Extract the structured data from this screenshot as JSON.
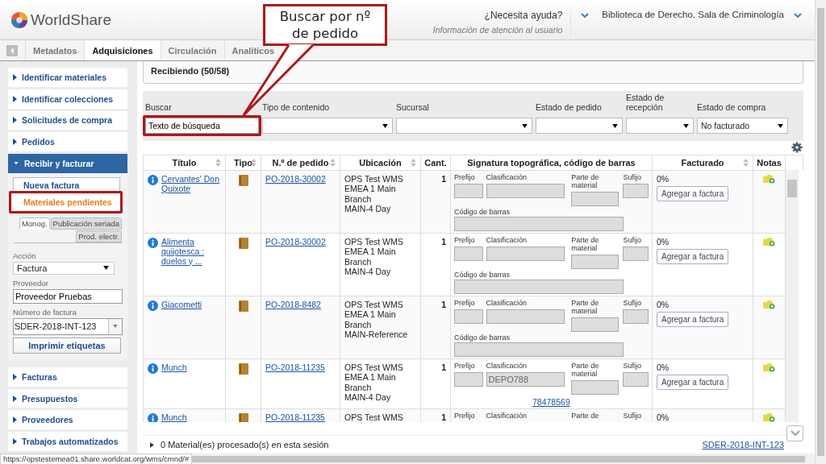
{
  "header": {
    "logo": "WorldShare",
    "help": {
      "label": "¿Necesita ayuda?",
      "sub": "Información de atención al usuario"
    },
    "institution": "Biblioteca de Derecho. Sala de Criminología"
  },
  "tabs": [
    {
      "label": "Metadatos",
      "selected": false
    },
    {
      "label": "Adquisiciones",
      "selected": true
    },
    {
      "label": "Circulación",
      "selected": false
    },
    {
      "label": "Analíticos",
      "selected": false
    }
  ],
  "sidebar": {
    "items": [
      {
        "label": "Identificar materiales",
        "expanded": false
      },
      {
        "label": "Identificar colecciones",
        "expanded": false
      },
      {
        "label": "Solicitudes de compra",
        "expanded": false
      },
      {
        "label": "Pedidos",
        "expanded": false
      },
      {
        "label": "Recibir y facturar",
        "expanded": true,
        "links": [
          {
            "label": "Nueva factura",
            "selected": false,
            "highlighted": false
          },
          {
            "label": "Materiales pendientes",
            "selected": true,
            "highlighted": true
          }
        ],
        "subtabs": [
          {
            "label": "Monog.",
            "selected": true
          },
          {
            "label": "Publicación seriada",
            "selected": false
          },
          {
            "label": "Prod. electr.",
            "selected": false
          }
        ],
        "form": {
          "action": {
            "label": "Acción",
            "value": "Factura"
          },
          "vendor": {
            "label": "Proveedor",
            "value": "Proveedor Pruebas"
          },
          "invoice": {
            "label": "Número de factura",
            "value": "SDER-2018-INT-123"
          },
          "button": "Imprimir etiquetas"
        }
      },
      {
        "label": "Facturas",
        "expanded": false
      },
      {
        "label": "Presupuestos",
        "expanded": false
      },
      {
        "label": "Proveedores",
        "expanded": false
      },
      {
        "label": "Trabajos automatizados",
        "expanded": false
      }
    ]
  },
  "main": {
    "title": "Recibiendo (50/58)",
    "filters": [
      {
        "kind": "text",
        "label": "Buscar",
        "value": "Texto de búsqueda",
        "highlighted": true
      },
      {
        "kind": "select",
        "label": "Tipo de contenido",
        "highlighted": false
      },
      {
        "kind": "select",
        "label": "Sucursal",
        "highlighted": false
      },
      {
        "kind": "select",
        "label": "Estado de pedido",
        "highlighted": false
      },
      {
        "kind": "select",
        "label": "Estado de recepción",
        "highlighted": false
      },
      {
        "kind": "select",
        "label": "Estado de compra",
        "value": "No facturado",
        "highlighted": false
      }
    ],
    "table": {
      "columns": [
        {
          "label": "Título",
          "sortable": true
        },
        {
          "label": "Tipo",
          "sortable": true
        },
        {
          "label": "N.º de pedido",
          "sortable": true
        },
        {
          "label": "Ubicación",
          "sortable": true
        },
        {
          "label": "Cant.",
          "sortable": false
        },
        {
          "label": "Signatura topográfica, código de barras",
          "sortable": false
        },
        {
          "label": "Facturado",
          "sortable": true
        },
        {
          "label": "Notas",
          "sortable": false
        }
      ],
      "rows": [
        {
          "kind": "barcode_field",
          "title": "Cervantes' Don Quixote",
          "order": "PO-2018-30002",
          "location": [
            "OPS Test WMS",
            "EMEA 1 Main",
            "Branch",
            "MAIN-4 Day"
          ],
          "quantity": "1",
          "call_labels": [
            "Prefijo",
            "Clasificación",
            "Parte de material",
            "Sufijo"
          ],
          "barcode_label": "Código de barras",
          "invoiced": "0%",
          "button": "Agregar a factura"
        },
        {
          "kind": "barcode_field",
          "title": "Alimenta quijotesca : duelos y ...",
          "order": "PO-2018-30002",
          "location": [
            "OPS Test WMS",
            "EMEA 1 Main",
            "Branch",
            "MAIN-4 Day"
          ],
          "quantity": "1",
          "call_labels": [
            "Prefijo",
            "Clasificación",
            "Parte de material",
            "Sufijo"
          ],
          "barcode_label": "Código de barras",
          "invoiced": "0%",
          "button": "Agregar a factura"
        },
        {
          "kind": "barcode_field",
          "title": "Giacometti",
          "order": "PO-2018-8482",
          "location": [
            "OPS Test WMS",
            "EMEA 1 Main",
            "Branch",
            "MAIN-Reference"
          ],
          "quantity": "1",
          "call_labels": [
            "Prefijo",
            "Clasificación",
            "Parte de material",
            "Sufijo"
          ],
          "barcode_label": "Código de barras",
          "invoiced": "0%",
          "button": "Agregar a factura"
        },
        {
          "kind": "barcode_link",
          "title": "Munch",
          "order": "PO-2018-11235",
          "location": [
            "OPS Test WMS",
            "EMEA 1 Main",
            "Branch",
            "MAIN-4 Day"
          ],
          "quantity": "1",
          "call_labels": [
            "Prefijo",
            "Clasificación",
            "Parte de material",
            "Sufijo"
          ],
          "classification": "DEPO788",
          "barcode": "78478569",
          "invoiced": "0%",
          "button": "Agregar a factura"
        },
        {
          "kind": "cut",
          "title": "Munch",
          "order": "PO-2018-11235",
          "location": [
            "OPS Test WMS"
          ],
          "quantity": "1",
          "call_labels": [
            "Prefijo",
            "Clasificación",
            "Parte de",
            "Sufijo"
          ],
          "invoiced": "0%"
        }
      ]
    },
    "footer": {
      "summary": "0 Material(es) procesado(s) en esta sesión",
      "invoice_link": "SDER-2018-INT-123"
    }
  },
  "callout": {
    "text": "Buscar por nº de pedido"
  },
  "status_bar": {
    "url": "https://opstestemea01.share.worldcat.org/wms/cmnd/#"
  }
}
